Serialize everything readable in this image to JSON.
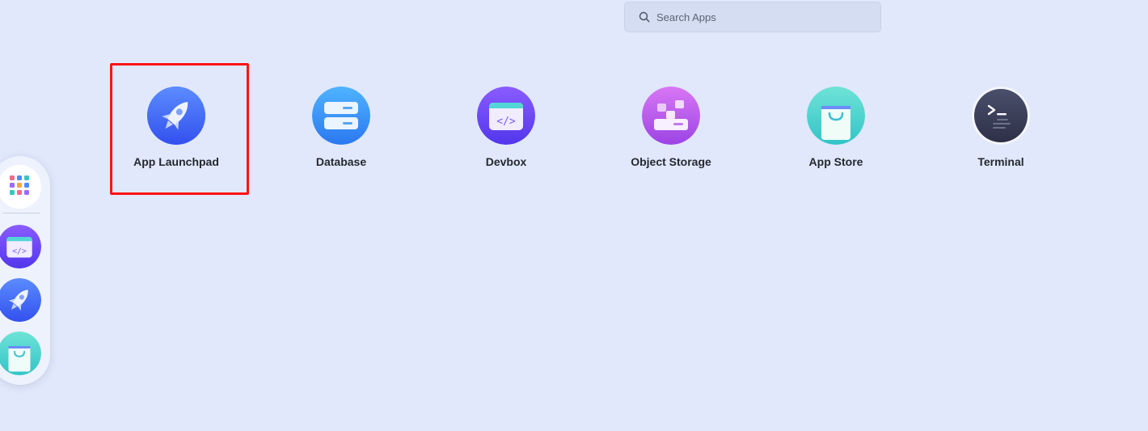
{
  "search": {
    "placeholder": "Search Apps"
  },
  "apps": [
    {
      "label": "App Launchpad",
      "icon": "rocket-icon"
    },
    {
      "label": "Database",
      "icon": "database-icon"
    },
    {
      "label": "Devbox",
      "icon": "code-folder-icon"
    },
    {
      "label": "Object Storage",
      "icon": "storage-blocks-icon"
    },
    {
      "label": "App Store",
      "icon": "shopping-bag-icon"
    },
    {
      "label": "Terminal",
      "icon": "terminal-icon"
    }
  ],
  "dock": {
    "items": [
      {
        "icon": "app-grid-icon"
      },
      {
        "icon": "code-folder-icon"
      },
      {
        "icon": "rocket-icon"
      },
      {
        "icon": "shopping-bag-icon"
      }
    ]
  },
  "colors": {
    "background": "#e1e8fb",
    "highlight": "#ff1212",
    "launchpad": "#3f6bf5",
    "database": "#3a96f4",
    "devbox": "#6a45f0",
    "storage": "#b657ea",
    "appstore": "#4fd6cf",
    "terminal": "#3b3f58"
  }
}
